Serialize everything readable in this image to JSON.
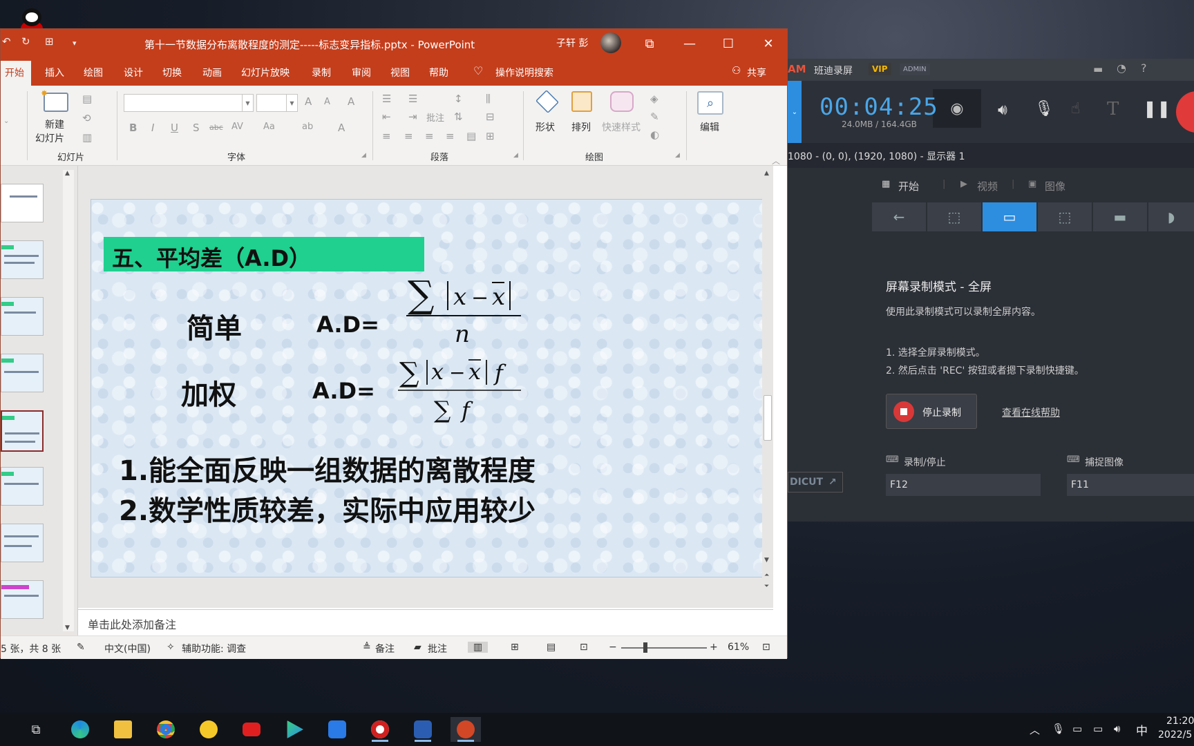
{
  "ppt": {
    "title": "第十一节数据分布离散程度的测定-----标志变异指标.pptx  -  PowerPoint",
    "user": "子轩 彭",
    "tabs": [
      "开始",
      "插入",
      "绘图",
      "设计",
      "切换",
      "动画",
      "幻灯片放映",
      "录制",
      "审阅",
      "视图",
      "帮助"
    ],
    "tell_me": "操作说明搜索",
    "share": "共享",
    "ribbon": {
      "new_slide": "新建\n幻灯片",
      "new_slide_l1": "新建",
      "new_slide_l2": "幻灯片",
      "groups": {
        "slides": "幻灯片",
        "font": "字体",
        "paragraph": "段落",
        "drawing": "绘图"
      },
      "shape": "形状",
      "arrange": "排列",
      "quick_styles": "快速样式",
      "edit": "编辑"
    },
    "slide": {
      "title": "五、平均差（A.D）",
      "simple": "简单",
      "weighted": "加权",
      "ad": "A.D=",
      "points": [
        "1.能全面反映一组数据的离散程度",
        "2.数学性质较差，实际中应用较少"
      ]
    },
    "notes_placeholder": "单击此处添加备注",
    "status": {
      "slide_count": "5 张，共 8 张",
      "lang": "中文(中国)",
      "accessibility": "辅助功能: 调查",
      "notes": "备注",
      "comments": "批注",
      "zoom": "61%"
    }
  },
  "recorder": {
    "brand": "班迪录屏",
    "vip": "VIP",
    "admin": "ADMIN",
    "brand_prefix": "AM",
    "time": "00:04:25",
    "size": "24.0MB / 164.4GB",
    "info": "1080 - (0, 0), (1920, 1080) - 显示器 1",
    "tabs": [
      "开始",
      "视频",
      "图像"
    ],
    "mode_title": "屏幕录制模式 - 全屏",
    "mode_desc": "使用此录制模式可以录制全屏内容。",
    "steps": [
      "1. 选择全屏录制模式。",
      "2. 然后点击 'REC' 按钮或者摁下录制快捷键。"
    ],
    "stop": "停止录制",
    "help": "查看在线帮助",
    "hotkey_rec_label": "录制/停止",
    "hotkey_rec": "F12",
    "hotkey_cap_label": "捕捉图像",
    "hotkey_cap": "F11",
    "bandicut": "DICUT"
  },
  "tray": {
    "ime": "中",
    "time": "21:20",
    "date": "2022/5"
  }
}
